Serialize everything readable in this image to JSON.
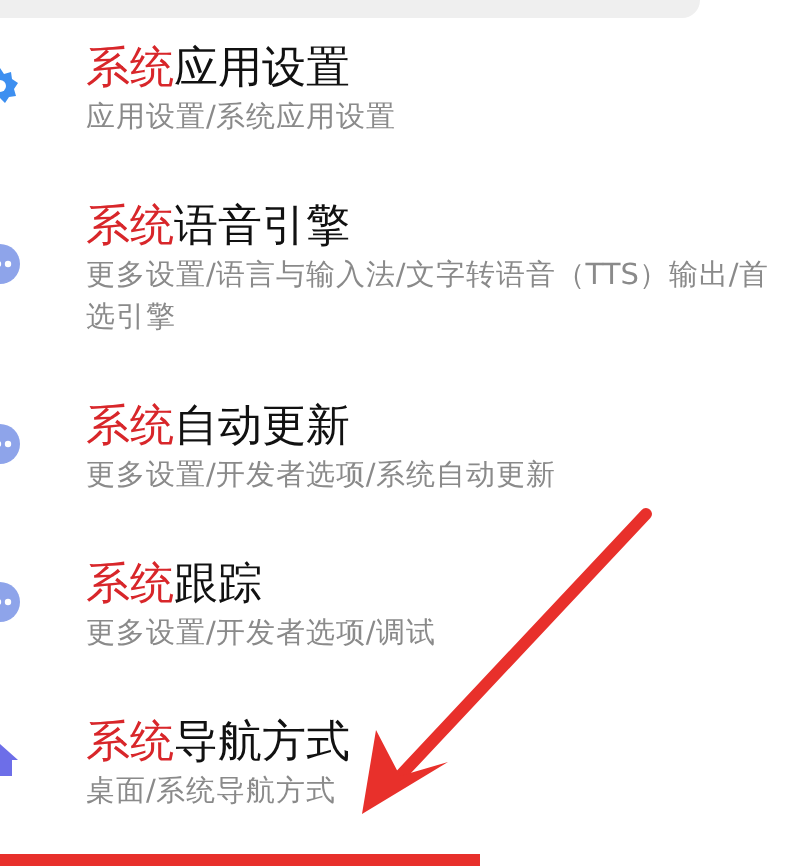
{
  "results": [
    {
      "kind": "gear",
      "title": "**系统**应用设置",
      "path": "应用设置/系统应用设置"
    },
    {
      "kind": "dots",
      "title": "**系统**语音引擎",
      "path": "更多设置/语言与输入法/文字转语音（TTS）输出/首选引擎"
    },
    {
      "kind": "dots",
      "title": "**系统**自动更新",
      "path": "更多设置/开发者选项/系统自动更新"
    },
    {
      "kind": "dots",
      "title": "**系统**跟踪",
      "path": "更多设置/开发者选项/调试"
    },
    {
      "kind": "home",
      "title": "**系统**导航方式",
      "path": "桌面/系统导航方式"
    }
  ]
}
